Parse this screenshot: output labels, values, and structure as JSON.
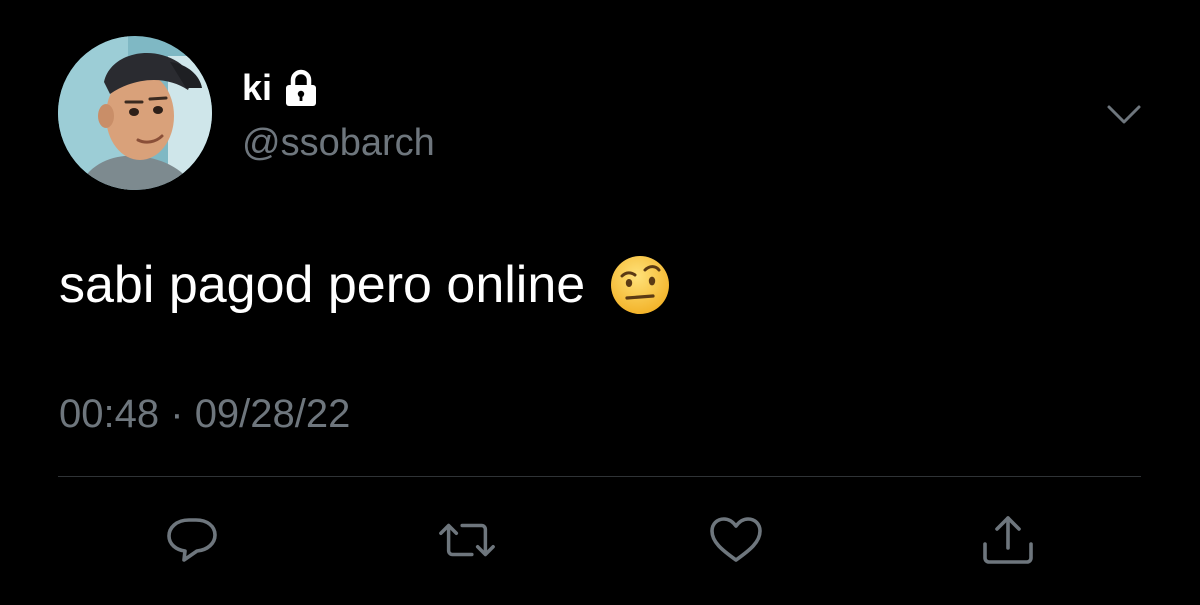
{
  "tweet": {
    "author": {
      "display_name": "ki",
      "handle": "@ssobarch",
      "protected": true
    },
    "text": "sabi pagod pero online",
    "emoji": "face-with-raised-eyebrow",
    "time": "00:48",
    "separator": "·",
    "date": "09/28/22"
  },
  "actions": [
    "reply",
    "retweet",
    "like",
    "share"
  ],
  "colors": {
    "background": "#000000",
    "text": "#ffffff",
    "secondary": "#6e767d",
    "divider": "#2f3336"
  }
}
